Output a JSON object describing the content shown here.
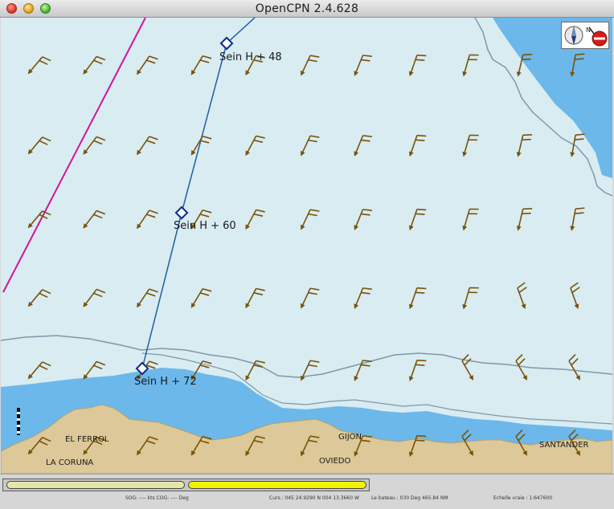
{
  "window": {
    "title": "OpenCPN 2.4.628"
  },
  "chart": {
    "route_points": [
      {
        "label": "Sein H + 48"
      },
      {
        "label": "Sein H + 60"
      },
      {
        "label": "Sein H + 72"
      }
    ],
    "place_names": {
      "el_ferrol": "EL FERROL",
      "la_coruna": "LA CORUNA",
      "gijon": "GIJON",
      "oviedo": "OVIEDO",
      "santander": "SANTANDER"
    },
    "colors": {
      "deep_water": "#d8ecf2",
      "shallow_water": "#6cb8ea",
      "land": "#dcc898",
      "route": "#1f5fa0",
      "track": "#d0169a",
      "wind_barb": "#7a5208"
    }
  },
  "status": {
    "sog_cog": "SOG: ---- kts  COG: ---- Deg",
    "cursor": "Curs.: 045 24.9290 N 004 13.3660 W",
    "bearing": "Le bateau : 030 Deg  465.84 NM",
    "scale": "Echelle vraie : 1:647600"
  }
}
